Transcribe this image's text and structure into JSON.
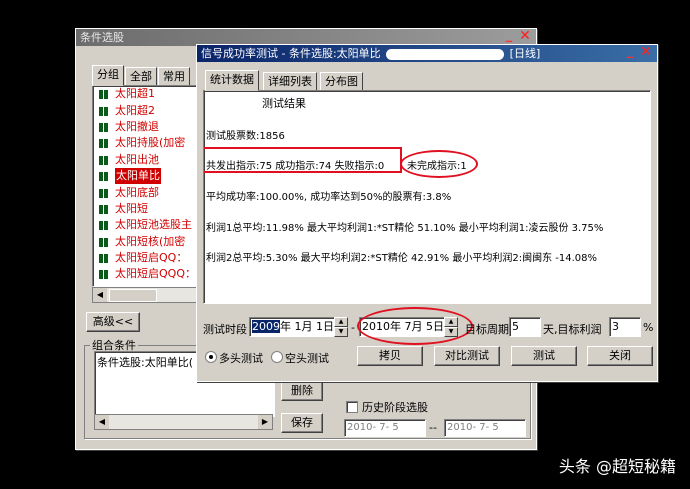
{
  "back_window": {
    "title": "条件选股",
    "tabs": [
      "分组",
      "全部",
      "常用"
    ],
    "list_items": [
      "太阳超1",
      "太阳超2",
      "太阳撤退",
      "太阳持股(加密",
      "太阳出池",
      "太阳单比",
      "太阳底部",
      "太阳短",
      "太阳短池选股主",
      "太阳短核(加密",
      "太阳短启QQ：",
      "太阳短启QQQ："
    ],
    "selected_index": 5,
    "advanced_button": "高级<<",
    "combo_label": "组合条件",
    "combo_value": "条件选股:太阳单比(",
    "delete_button": "删除",
    "save_button": "保存",
    "history_checkbox_label": "历史阶段选股",
    "history_from": "2010- 7- 5",
    "history_sep": "--",
    "history_to": "2010- 7- 5"
  },
  "front_window": {
    "title": "信号成功率测试 - 条件选股:太阳单比",
    "title_suffix": "[日线]",
    "tabs": [
      "统计数据",
      "详细列表",
      "分布图"
    ],
    "result_title": "测试结果",
    "lines": [
      "测试股票数:1856",
      "共发出指示:75 成功指示:74 失败指示:0",
      "未完成指示:1",
      "平均成功率:100.00%, 成功率达到50%的股票有:3.8%",
      "利润1总平均:11.98% 最大平均利润1:*ST精伦 51.10% 最小平均利润1:凌云股份 3.75%",
      "利润2总平均:5.30% 最大平均利润2:*ST精伦 42.91% 最小平均利润2:闽闽东   -14.08%"
    ],
    "period_label": "测试时段",
    "from_year": "2009",
    "from_rest": "年 1月 1日",
    "dash": "-",
    "to_date": "2010年 7月 5日",
    "target_label": "目标周期",
    "target_value": "5",
    "target_unit": "天,目标利润",
    "profit_value": "3",
    "profit_unit": "%",
    "radio_long": "多头测试",
    "radio_short": "空头测试",
    "btn_copy": "拷贝",
    "btn_compare": "对比测试",
    "btn_test": "测试",
    "btn_close": "关闭"
  },
  "watermark": "头条 @超短秘籍"
}
